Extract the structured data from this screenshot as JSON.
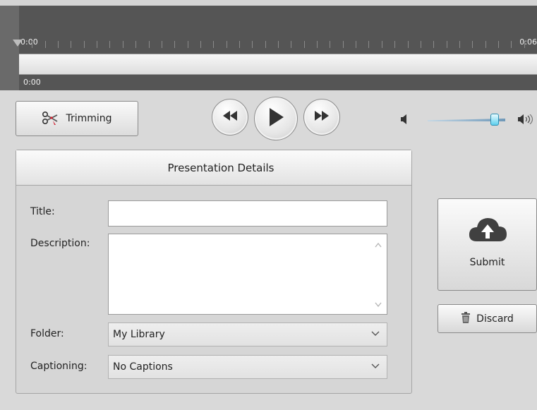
{
  "timeline": {
    "start_label": "0:00",
    "end_label": "0:06",
    "current_time": "0:00"
  },
  "controls": {
    "trim_label": "Trimming",
    "volume_level": 0.86,
    "accent_color": "#5fd0ee"
  },
  "panel": {
    "header": "Presentation Details",
    "title_label": "Title:",
    "title_value": "",
    "description_label": "Description:",
    "description_value": "",
    "folder_label": "Folder:",
    "folder_value": "My Library",
    "captioning_label": "Captioning:",
    "captioning_value": "No Captions"
  },
  "actions": {
    "submit_label": "Submit",
    "discard_label": "Discard"
  },
  "icons": {
    "trim": "scissors-icon",
    "rewind": "rewind-icon",
    "play": "play-icon",
    "fast_forward": "fast-forward-icon",
    "volume_low": "volume-low-icon",
    "volume_high": "volume-high-icon",
    "upload": "cloud-upload-icon",
    "discard": "trash-icon",
    "dropdown": "chevron-down-icon"
  }
}
